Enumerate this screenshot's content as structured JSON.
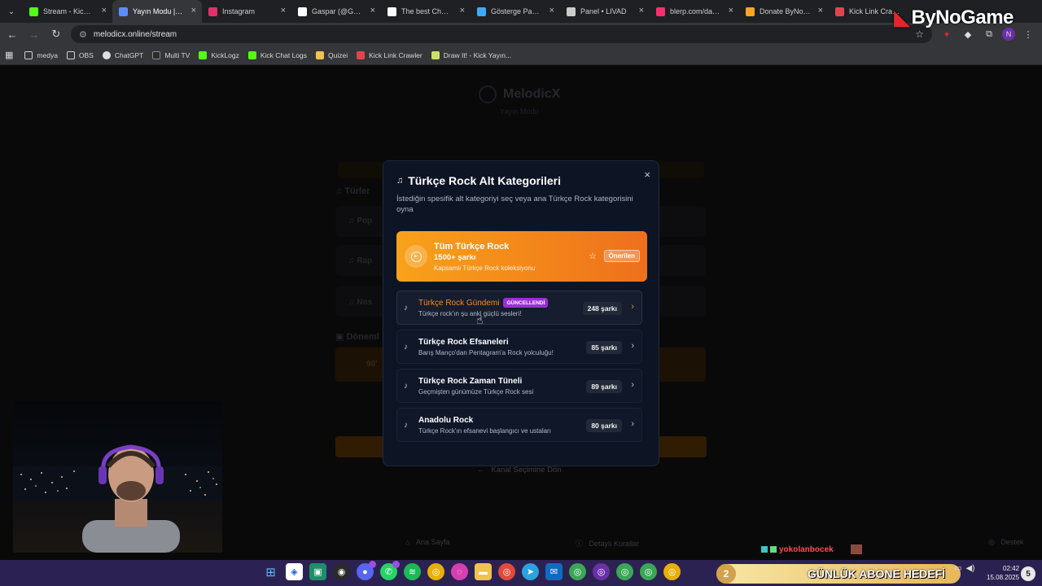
{
  "tabs": [
    {
      "label": "Stream - Kick Dashboard",
      "color": "#53fc18",
      "active": false
    },
    {
      "label": "Yayın Modu | MelodicX",
      "color": "#5b8cff",
      "active": true
    },
    {
      "label": "Instagram",
      "color": "#e1306c",
      "active": false
    },
    {
      "label": "Gaspar (@Gaspar...",
      "color": "#ffffff",
      "active": false
    },
    {
      "label": "The best ChatBot",
      "color": "#ffffff",
      "active": false
    },
    {
      "label": "Gösterge Paneli -",
      "color": "#3fa9f5",
      "active": false
    },
    {
      "label": "Panel • LIVAD",
      "color": "#cccccc",
      "active": false
    },
    {
      "label": "blerp.com/dashbo",
      "color": "#ff2d6f",
      "active": false
    },
    {
      "label": "Donate ByNoGame",
      "color": "#f5a623",
      "active": false
    },
    {
      "label": "Kick Link Crawler",
      "color": "#e0454f",
      "active": false
    }
  ],
  "address": {
    "url": "melodicx.online/stream"
  },
  "bookmarks": [
    {
      "label": "medya",
      "icon": "folder-icon"
    },
    {
      "label": "OBS",
      "icon": "folder-icon"
    },
    {
      "label": "ChatGPT",
      "icon": "chatgpt-icon"
    },
    {
      "label": "Multi TV",
      "icon": "multitv-icon"
    },
    {
      "label": "KickLogz",
      "icon": "kick-icon"
    },
    {
      "label": "Kick Chat Logs",
      "icon": "kick-icon"
    },
    {
      "label": "Quizei",
      "icon": "quizei-icon"
    },
    {
      "label": "Kick Link Crawler",
      "icon": "crawler-icon"
    },
    {
      "label": "Draw It! - Kick Yayın...",
      "icon": "drawit-icon"
    }
  ],
  "background": {
    "logo": "MelodicX",
    "subtitle": "Yayın Modu",
    "section_genres": "Türler",
    "genre_items": [
      "Pop",
      "Rap",
      "Nos"
    ],
    "section_eras": "Döneml",
    "era_item": "90'",
    "back_link": "Kanal Seçimine Dön",
    "footer": {
      "home": "Ana Sayfa",
      "rules": "Detaylı Kurallar",
      "support": "Destek"
    }
  },
  "modal": {
    "title": "Türkçe Rock Alt Kategorileri",
    "description": "İstediğin spesifik alt kategoriyi seç veya ana Türkçe Rock kategorisini oyna",
    "close_label": "×",
    "featured": {
      "title": "Tüm Türkçe Rock",
      "count": "1500+ şarkı",
      "desc": "Kapsamlı Türkçe Rock koleksiyonu",
      "badge": "Önerilen"
    },
    "subcategories": [
      {
        "title": "Türkçe Rock Gündemi",
        "badge": "GÜNCELLENDİ",
        "desc": "Türkçe rock'ın şu anki güçlü sesleri!",
        "count": "248 şarkı"
      },
      {
        "title": "Türkçe Rock Efsaneleri",
        "badge": "",
        "desc": "Barış Manço'dan Pentagram'a Rock yolculuğu!",
        "count": "85 şarkı"
      },
      {
        "title": "Türkçe Rock Zaman Tüneli",
        "badge": "",
        "desc": "Geçmişten günümüze Türkçe Rock sesi",
        "count": "89 şarkı"
      },
      {
        "title": "Anadolu Rock",
        "badge": "",
        "desc": "Türkçe Rock'ın efsanevi başlangıcı ve ustaları",
        "count": "80 şarkı"
      }
    ]
  },
  "stream_overlay": {
    "brand": "ByNoGame",
    "chat_user": "yokolanbocek",
    "goal_count": "2",
    "goal_label": "GÜNLÜK ABONE HEDEFİ"
  },
  "taskbar": {
    "time": "02:42",
    "date": "15.08.2025",
    "notification_count": "5"
  }
}
